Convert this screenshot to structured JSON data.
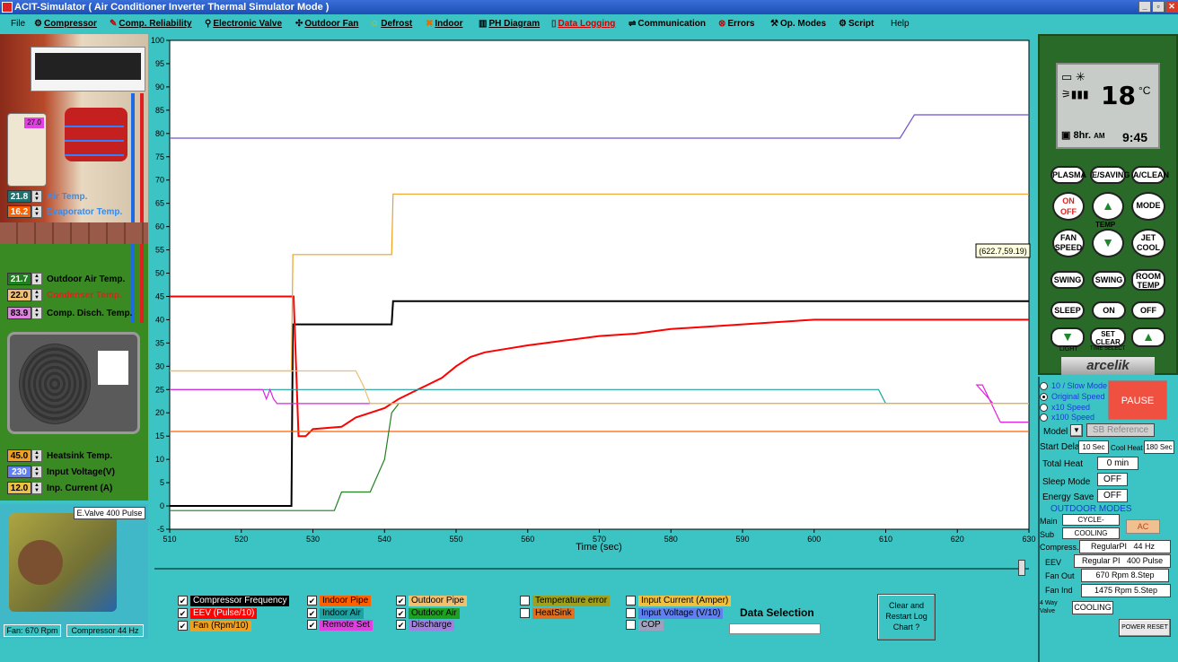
{
  "window": {
    "title": "ACIT-Simulator    ( Air Conditioner Inverter Thermal Simulator  Mode )"
  },
  "menu": {
    "file": "File",
    "compressor": "Compressor",
    "comp_reliability": "Comp. Reliability",
    "electronic_valve": "Electronic  Valve",
    "outdoor_fan": "Outdoor Fan",
    "defrost": "Defrost",
    "indoor": "Indoor",
    "ph_diagram": "PH Diagram",
    "data_logging": "Data Logging",
    "communication": "Communication",
    "errors": "Errors",
    "op_modes": "Op. Modes",
    "script": "Script",
    "help": "Help"
  },
  "left": {
    "remote_display": "27.0",
    "air_temp": {
      "value": "21.8",
      "label": "Air Temp."
    },
    "evap_temp": {
      "value": "16.2",
      "label": "Evaporator Temp."
    },
    "outdoor_air": {
      "value": "21.7",
      "label": "Outdoor Air Temp."
    },
    "condenser": {
      "value": "22.0",
      "label": "Condenser Temp."
    },
    "comp_disch": {
      "value": "83.9",
      "label": "Comp. Disch. Temp."
    },
    "heatsink": {
      "value": "45.0",
      "label": "Heatsink Temp."
    },
    "input_voltage": {
      "value": "230",
      "label": "Input Voltage(V)"
    },
    "inp_current": {
      "value": "12.0",
      "label": "Inp. Current (A)"
    },
    "evalve": "E.Valve 400 Pulse",
    "fan_rpm": "Fan: 670 Rpm",
    "compressor_hz": "Compressor 44 Hz"
  },
  "chart_data": {
    "type": "line",
    "xlabel": "Time (sec)",
    "ylabel": "",
    "xlim": [
      510,
      630
    ],
    "ylim": [
      -5,
      100
    ],
    "xticks": [
      510,
      520,
      530,
      540,
      550,
      560,
      570,
      580,
      590,
      600,
      610,
      620,
      630
    ],
    "yticks": [
      100,
      95,
      90,
      85,
      80,
      75,
      70,
      65,
      60,
      55,
      50,
      45,
      40,
      35,
      30,
      25,
      20,
      15,
      10,
      5,
      0,
      -5
    ],
    "tooltip": "(622.7,59.19)",
    "grid": false,
    "series": [
      {
        "name": "Compressor Frequency",
        "color": "#000000",
        "x": [
          510,
          527,
          527.2,
          541,
          541.2,
          630
        ],
        "y": [
          0,
          0,
          39,
          39,
          44,
          44
        ]
      },
      {
        "name": "EEV (Pulse/10)",
        "color": "#ff0000",
        "x": [
          510,
          527,
          527.3,
          528,
          529,
          530,
          534,
          536,
          538,
          540,
          542,
          544,
          546,
          548,
          550,
          552,
          554,
          556,
          560,
          565,
          570,
          575,
          580,
          585,
          590,
          595,
          600,
          630
        ],
        "y": [
          45,
          45,
          45,
          15,
          15,
          16.5,
          17,
          19,
          20,
          21,
          23,
          24.5,
          26,
          27.5,
          30,
          32,
          33,
          33.5,
          34.5,
          35.5,
          36.5,
          37,
          38,
          38.5,
          39,
          39.5,
          40,
          40
        ]
      },
      {
        "name": "Fan (Rpm/10)",
        "color": "#f0a020",
        "x": [
          510,
          527,
          527.2,
          541,
          541.2,
          630
        ],
        "y": [
          29,
          29,
          54,
          54,
          67,
          67
        ]
      },
      {
        "name": "Indoor Pipe",
        "color": "#ff6000",
        "x": [
          510,
          630
        ],
        "y": [
          16,
          16
        ]
      },
      {
        "name": "Outdoor Pipe",
        "color": "#7050d0",
        "x": [
          510,
          612,
          614,
          630
        ],
        "y": [
          79,
          79,
          84,
          84
        ]
      },
      {
        "name": "Indoor Air",
        "color": "#20a0a0",
        "x": [
          510,
          609,
          610,
          630
        ],
        "y": [
          25,
          25,
          22,
          22
        ]
      },
      {
        "name": "Outdoor Air",
        "color": "#208020",
        "x": [
          510,
          533,
          534,
          538,
          540,
          541,
          542,
          630
        ],
        "y": [
          -1,
          -1,
          3,
          3,
          10,
          20,
          22,
          22
        ]
      },
      {
        "name": "Remote Set",
        "color": "#e020e0",
        "x": [
          510,
          523,
          523.5,
          524,
          524.5,
          525,
          625,
          622.7,
          623.5,
          626,
          630
        ],
        "y": [
          25,
          25,
          23,
          25,
          23,
          22,
          22,
          26,
          26,
          18,
          18
        ]
      },
      {
        "name": "Temperature error",
        "color": "#e8c070",
        "x": [
          510,
          536,
          537,
          538,
          630
        ],
        "y": [
          29,
          29,
          26,
          22,
          22
        ]
      }
    ]
  },
  "legend": {
    "compressor_frequency": "Compressor Frequency",
    "eev": "EEV (Pulse/10)",
    "fan": "Fan (Rpm/10)",
    "indoor_pipe": "Indoor Pipe",
    "indoor_air": "Indoor Air",
    "remote_set": "Remote Set",
    "outdoor_pipe": "Outdoor Pipe",
    "outdoor_air": "Outdoor Air",
    "discharge": "Discharge",
    "temperature_error": "Temperature error",
    "heatsink": "HeatSink",
    "input_current": "Input Current (Amper)",
    "input_voltage": "Input Voltage (V/10)",
    "cop": "COP",
    "data_selection": "Data Selection",
    "clear_restart": "Clear and Restart Log Chart ?"
  },
  "remote": {
    "temp": "18",
    "unit": "°C",
    "time_prefix": "8hr.",
    "ampm": "AM",
    "time": "9:45",
    "buttons": {
      "plasma": "PLASMA",
      "esaving": "E/SAVING",
      "aclean": "A/CLEAN",
      "onoff_on": "ON",
      "onoff_off": "OFF",
      "temp_label": "TEMP",
      "mode": "MODE",
      "fan_speed": "FAN SPEED",
      "jet_cool": "JET COOL",
      "swing1": "SWING",
      "swing2": "SWING",
      "room_temp": "ROOM TEMP",
      "sleep": "SLEEP",
      "on": "ON",
      "off": "OFF",
      "light": "LIGHT",
      "set_clear": "SET CLEAR",
      "time_label": "TIME SELECT"
    },
    "brand": "arcelik"
  },
  "controls": {
    "speed_options": [
      "10 / Slow Mode",
      "Original Speed",
      "x10 Speed",
      "x100 Speed"
    ],
    "selected_speed": "Original Speed",
    "pause": "PAUSE",
    "model_label": "Model",
    "model_value": "SB Reference",
    "start_delay_label": "Start Delay",
    "start_delay": "10 Sec",
    "cool_heat_label": "Cool Heat",
    "cool_heat": "180 Sec",
    "total_heat_label": "Total Heat",
    "total_heat": "0 min",
    "sleep_mode_label": "Sleep Mode",
    "sleep_mode": "OFF",
    "energy_save_label": "Energy Save",
    "energy_save": "OFF",
    "outdoor_modes": "OUTDOOR MODES",
    "main_label": "Main",
    "main": "CYCLE-",
    "ac": "AC",
    "sub_label": "Sub",
    "sub": "COOLING",
    "compress_label": "Compress.",
    "compress_mode": "RegularPI",
    "compress_hz": "44 Hz",
    "eev_label": "EEV",
    "eev_mode": "Regular PI",
    "eev_pulse": "400 Pulse",
    "fan_out_label": "Fan Out",
    "fan_out": "670 Rpm  8.Step",
    "fan_ind_label": "Fan Ind",
    "fan_ind": "1475 Rpm  5.Step",
    "four_way_label": "4 Way Valve",
    "four_way": "COOLING",
    "power_reset": "POWER RESET"
  }
}
